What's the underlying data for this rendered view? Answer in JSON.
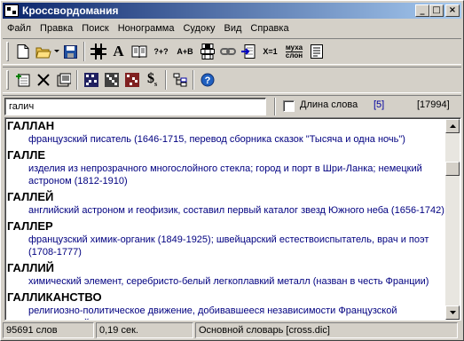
{
  "window": {
    "title": "Кроссвордомания"
  },
  "menu": [
    "Файл",
    "Правка",
    "Поиск",
    "Нонограмма",
    "Судоку",
    "Вид",
    "Справка"
  ],
  "toolbar1": {
    "text_buttons": {
      "mask_query": "?+?",
      "a_plus_b": "A+B",
      "x_eq_1": "X=1",
      "muha": "муха",
      "slon": "слон"
    }
  },
  "search": {
    "value": "галич",
    "word_length_label": "Длина слова",
    "word_length_value": "[5]",
    "total_count": "[17994]"
  },
  "entries": [
    {
      "word": "ГАЛЛАН",
      "definition": "французский писатель (1646-1715, перевод сборника сказок \"Тысяча и одна ночь\")"
    },
    {
      "word": "ГАЛЛЕ",
      "definition": "изделия из непрозрачного многослойного стекла; город и порт в Шри-Ланка; немецкий астроном (1812-1910)"
    },
    {
      "word": "ГАЛЛЕЙ",
      "definition": "английский астроном и геофизик, составил первый каталог звезд Южного неба (1656-1742)"
    },
    {
      "word": "ГАЛЛЕР",
      "definition": "французский химик-органик (1849-1925); швейцарский естествоиспытатель, врач и поэт (1708-1777)"
    },
    {
      "word": "ГАЛЛИЙ",
      "definition": "химический элемент, серебристо-белый легкоплавкий металл (назван в честь Франции)"
    },
    {
      "word": "ГАЛЛИКАНСТВО",
      "definition": "религиозно-политическое движение, добивавшееся независимости Французской католической церкви от папства"
    }
  ],
  "status": {
    "word_count": "95691 слов",
    "time": "0,19 сек.",
    "dictionary": "Основной словарь [cross.dic]"
  }
}
